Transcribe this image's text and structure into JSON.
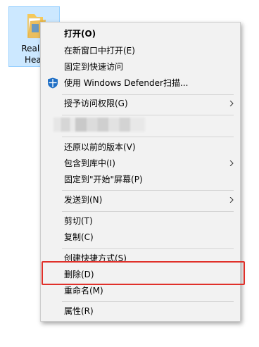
{
  "desktop": {
    "icon_label_line1": "RealM",
    "icon_label_line2": "Heal",
    "selection_color": "#cce8ff"
  },
  "menu": {
    "items": [
      {
        "label": "打开(O)",
        "bold": true
      },
      {
        "label": "在新窗口中打开(E)"
      },
      {
        "label": "固定到快速访问"
      },
      {
        "label": "使用 Windows Defender扫描...",
        "icon": "windows-defender-shield-icon"
      },
      {
        "label": "授予访问权限(G)",
        "submenu": true
      },
      {
        "label": "还原以前的版本(V)"
      },
      {
        "label": "包含到库中(I)",
        "submenu": true
      },
      {
        "label": "固定到\"开始\"屏幕(P)"
      },
      {
        "label": "发送到(N)",
        "submenu": true
      },
      {
        "label": "剪切(T)"
      },
      {
        "label": "复制(C)"
      },
      {
        "label": "创建快捷方式(S)"
      },
      {
        "label": "删除(D)",
        "highlighted": true
      },
      {
        "label": "重命名(M)"
      },
      {
        "label": "属性(R)"
      }
    ]
  },
  "colors": {
    "menu_bg": "#f2f2f2",
    "highlight_border": "#e0302a",
    "separator": "#d5d5d5"
  }
}
